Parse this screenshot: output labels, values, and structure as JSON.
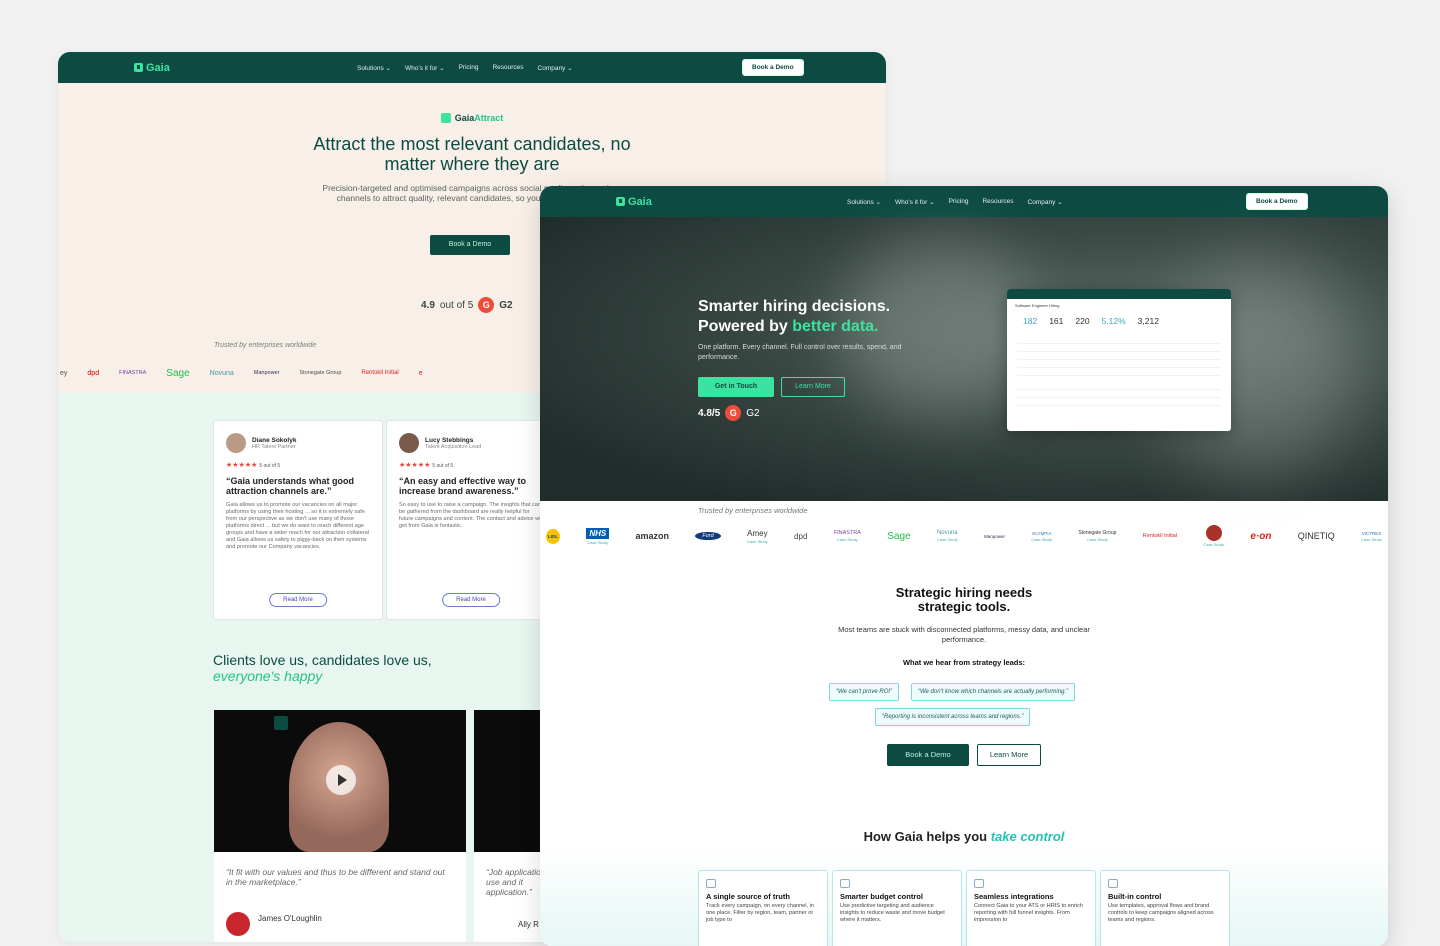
{
  "back": {
    "nav": {
      "logo": "Gaia",
      "links": [
        "Solutions ⌄",
        "Who's it for ⌄",
        "Pricing",
        "Resources",
        "Company ⌄"
      ],
      "cta": "Book a Demo"
    },
    "hero": {
      "brand_a": "Gaia",
      "brand_b": "Attract",
      "title": "Attract the most relevant candidates, no matter where they are",
      "subtitle": "Precision-targeted and optimised campaigns across social media and search channels to attract quality, relevant candidates, so you fill roles faster.",
      "button": "Book a Demo",
      "rating": "4.9",
      "rating_suffix": "out of 5",
      "rating_source": "G2"
    },
    "trusted": "Trusted by enterprises worldwide",
    "logos": [
      "ey",
      "dpd",
      "FINASTRA",
      "Sage",
      "Novuna",
      "Manpower",
      "Stonegate Group",
      "Rentokil Initial",
      "e"
    ],
    "testimonials": [
      {
        "name": "Diane Sokolyk",
        "role": "HR Talent Partner",
        "stars": "★★★★★",
        "score": "5 out of 5",
        "quote": "“Gaia understands what good attraction channels are.”",
        "body": "Gaia allows us to promote our vacancies on all major platforms by using their hosting ... so it is extremely safe from our perspective as we don't use many of those platforms direct ... but we do want to reach different age groups and have a wider reach for our attraction collateral and Gaia allows us safely to piggy-back on their systems and promote our Company vacancies.",
        "button": "Read More"
      },
      {
        "name": "Lucy Stebbings",
        "role": "Talent Acquisition Lead",
        "stars": "★★★★★",
        "score": "5 out of 5",
        "quote": "“An easy and effective way to increase brand awareness.”",
        "body": "So easy to use to raise a campaign. The insights that can be gathered from the dashboard are really helpful for future campaigns and content. The contact and advice we get from Gaia is fantastic.",
        "button": "Read More"
      }
    ],
    "clients_a": "Clients love us, candidates love us,",
    "clients_b": "everyone's happy",
    "videos": [
      {
        "quote": "“It fit with our values and thus to be different and stand out in the marketplace.”",
        "name": "James O'Loughlin"
      },
      {
        "quote": "“Job application to use and it application.”",
        "name": "Ally R"
      }
    ]
  },
  "front": {
    "nav": {
      "logo": "Gaia",
      "links": [
        "Solutions ⌄",
        "Who's it for ⌄",
        "Pricing",
        "Resources",
        "Company ⌄"
      ],
      "cta": "Book a Demo"
    },
    "hero": {
      "title_1": "Smarter hiring decisions.",
      "title_2a": "Powered by ",
      "title_2b": "better data.",
      "subtitle": "One platform. Every channel. Full control over results, spend, and performance.",
      "btn_primary": "Get in Touch",
      "btn_secondary": "Learn More",
      "rating": "4.8/5",
      "rating_source": "G2",
      "dashboard": {
        "title": "Software Engineer Hiring",
        "stats": [
          "182",
          "161",
          "220",
          "5.12%",
          "3,212"
        ]
      }
    },
    "trusted": "Trusted by enterprises worldwide",
    "logos": [
      {
        "name": "LIDL",
        "tag": ""
      },
      {
        "name": "NHS",
        "tag": "Case Study"
      },
      {
        "name": "amazon",
        "tag": ""
      },
      {
        "name": "Ford",
        "tag": ""
      },
      {
        "name": "Amey",
        "tag": "Case Study"
      },
      {
        "name": "dpd",
        "tag": ""
      },
      {
        "name": "FINASTRA",
        "tag": "Case Study"
      },
      {
        "name": "Sage",
        "tag": ""
      },
      {
        "name": "Novuna",
        "tag": "Case Study"
      },
      {
        "name": "Manpower",
        "tag": ""
      },
      {
        "name": "OLYMPIA",
        "tag": "Case Study"
      },
      {
        "name": "Stonegate Group",
        "tag": "Case Study"
      },
      {
        "name": "Rentokil Initial",
        "tag": ""
      },
      {
        "name": "",
        "tag": "Case Study"
      },
      {
        "name": "e·on",
        "tag": ""
      },
      {
        "name": "QINETIQ",
        "tag": ""
      },
      {
        "name": "VICTREX",
        "tag": "Case Study"
      }
    ],
    "strategic": {
      "title_1": "Strategic hiring needs",
      "title_2": "strategic tools.",
      "paragraph": "Most teams are stuck with disconnected platforms, messy data, and unclear performance.",
      "what_we_hear": "What we hear from strategy leads:",
      "chips": [
        "“We can't prove ROI”",
        "“We don't know which channels are actually performing.”",
        "“Reporting is inconsistent across teams and regions.”"
      ],
      "btn_primary": "Book a Demo",
      "btn_secondary": "Learn More"
    },
    "how": {
      "title_a": "How Gaia helps you ",
      "title_b": "take control",
      "features": [
        {
          "title": "A single source of truth",
          "body": "Track every campaign, on every channel, in one place. Filter by region, team, partner or job type to"
        },
        {
          "title": "Smarter budget control",
          "body": "Use predictive targeting and audience insights to reduce waste and move budget where it matters."
        },
        {
          "title": "Seamless integrations",
          "body": "Connect Gaia to your ATS or HRIS to enrich reporting with full funnel insights. From impression to"
        },
        {
          "title": "Built-in control",
          "body": "Use templates, approval flows and brand controls to keep campaigns aligned across teams and regions."
        }
      ]
    }
  },
  "colors": {
    "nav": "#0c4a42",
    "accent": "#3ce3a0",
    "g2": "#ef4b3b"
  }
}
